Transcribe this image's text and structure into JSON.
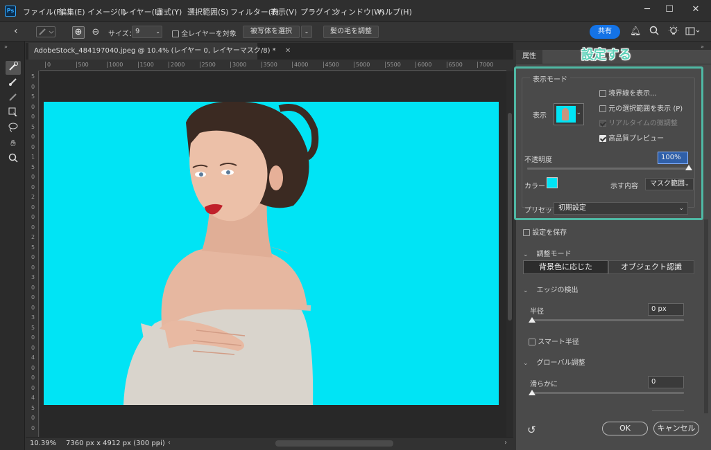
{
  "app": {
    "logo": "Ps"
  },
  "menu": [
    "ファイル(F)",
    "編集(E)",
    "イメージ(I)",
    "レイヤー(L)",
    "書式(Y)",
    "選択範囲(S)",
    "フィルター(T)",
    "表示(V)",
    "プラグイン",
    "ウィンドウ(W)",
    "ヘルプ(H)"
  ],
  "window_controls": {
    "minimize": "─",
    "maximize": "☐",
    "close": "✕"
  },
  "options": {
    "size_label": "サイズ：",
    "size_value": "9",
    "sample_all_label": "全レイヤーを対象",
    "select_subject": "被写体を選択",
    "refine_hair": "髪の毛を調整",
    "share": "共有"
  },
  "document": {
    "tab_title": "AdobeStock_484197040.jpeg @ 10.4% (レイヤー 0, レイヤーマスク/8) *",
    "ruler_top": [
      "0",
      "500",
      "1000",
      "1500",
      "2000",
      "2500",
      "3000",
      "3500",
      "4000",
      "4500",
      "5000",
      "5500",
      "6000",
      "6500",
      "7000"
    ],
    "ruler_left": [
      "5",
      "0",
      "5",
      "0",
      "0",
      "5",
      "0",
      "0",
      "1",
      "5",
      "0",
      "0",
      "2",
      "0",
      "0",
      "0",
      "2",
      "5",
      "0",
      "0",
      "3",
      "0",
      "0",
      "0",
      "3",
      "5",
      "0",
      "0",
      "4",
      "0",
      "0",
      "0",
      "4",
      "5",
      "0",
      "0"
    ],
    "zoom": "10.39%",
    "info": "7360 px x 4912 px (300 ppi)",
    "canvas_color": "#00e4f5"
  },
  "panel": {
    "tab": "属性",
    "view_mode_section": "表示モード",
    "view_label": "表示",
    "show_edge": "境界線を表示...",
    "show_original": "元の選択範囲を表示 (P)",
    "realtime": "リアルタイムの微調整",
    "high_quality": "高品質プレビュー",
    "opacity_label": "不透明度",
    "opacity_value": "100%",
    "opacity_level": 1.0,
    "color_label": "カラー",
    "overlay_color": "#00e4f5",
    "show_label": "示す内容",
    "show_value": "マスク範囲",
    "preset_label": "プリセット",
    "preset_value": "初期設定",
    "remember_settings": "設定を保存",
    "refine_mode_section": "調整モード",
    "color_aware": "背景色に応じた",
    "object_aware": "オブジェクト認識",
    "edge_detection_section": "エッジの検出",
    "radius_label": "半径",
    "radius_value": "0 px",
    "smart_radius": "スマート半径",
    "global_section": "グローバル調整",
    "smooth_label": "滑らかに",
    "smooth_value": "0",
    "ok": "OK",
    "cancel": "キャンセル"
  },
  "annotation": "設定する",
  "highlight_color": "#4fb8a4"
}
